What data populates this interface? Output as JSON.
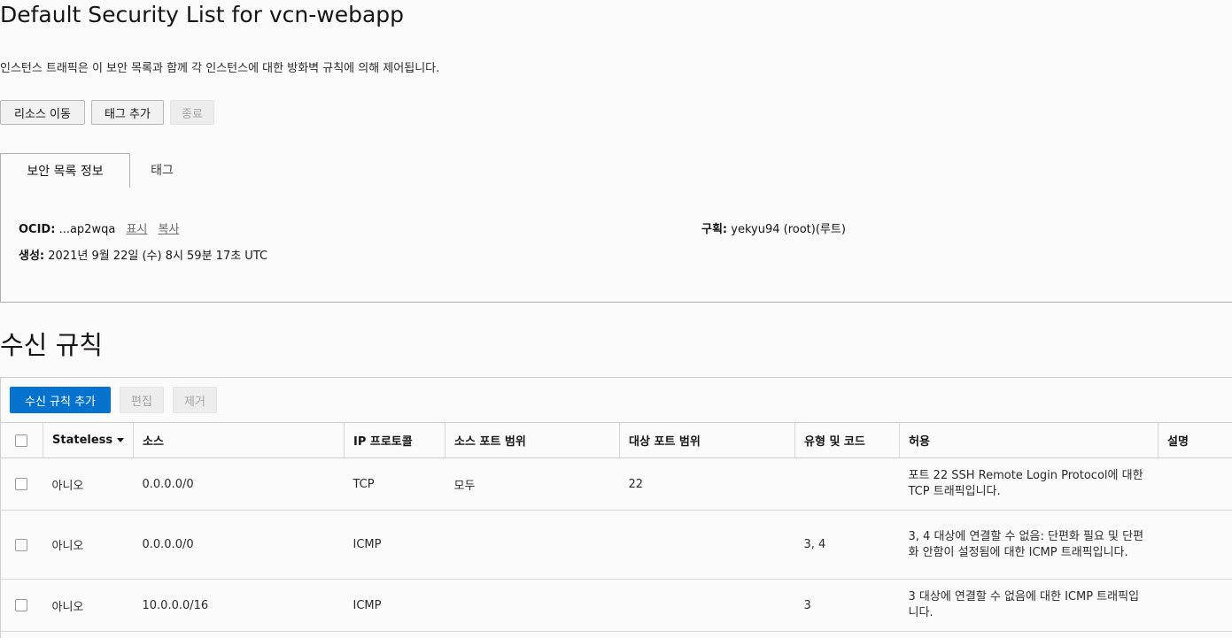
{
  "page": {
    "title": "Default Security List for vcn-webapp",
    "description": "인스턴스 트래픽은 이 보안 목록과 함께 각 인스턴스에 대한 방화벽 규칙에 의해 제어됩니다."
  },
  "actions": {
    "move_resource": "리소스 이동",
    "add_tags": "태그 추가",
    "terminate": "종료"
  },
  "tabs": [
    {
      "label": "보안 목록 정보",
      "active": true
    },
    {
      "label": "태그",
      "active": false
    }
  ],
  "info": {
    "ocid_label": "OCID:",
    "ocid_value": "...ap2wqa",
    "show_link": "표시",
    "copy_link": "복사",
    "created_label": "생성:",
    "created_value": "2021년 9월 22일 (수) 8시 59분 17초 UTC",
    "compartment_label": "구획:",
    "compartment_value": "yekyu94 (root)(루트)"
  },
  "ingress": {
    "title": "수신 규칙",
    "add_button": "수신 규칙 추가",
    "edit_button": "편집",
    "remove_button": "제거",
    "columns": [
      "Stateless",
      "소스",
      "IP 프로토콜",
      "소스 포트 범위",
      "대상 포트 범위",
      "유형 및 코드",
      "허용",
      "설명"
    ],
    "rows": [
      {
        "stateless": "아니오",
        "source": "0.0.0.0/0",
        "protocol": "TCP",
        "src_port": "모두",
        "dst_port": "22",
        "type_code": "",
        "allows": "포트 22 SSH Remote Login Protocol에 대한 TCP 트래픽입니다.",
        "description": ""
      },
      {
        "stateless": "아니오",
        "source": "0.0.0.0/0",
        "protocol": "ICMP",
        "src_port": "",
        "dst_port": "",
        "type_code": "3, 4",
        "allows": "3, 4 대상에 연결할 수 없음: 단편화 필요 및 단편화 안함이 설정됨에 대한 ICMP 트래픽입니다.",
        "description": ""
      },
      {
        "stateless": "아니오",
        "source": "10.0.0.0/16",
        "protocol": "ICMP",
        "src_port": "",
        "dst_port": "",
        "type_code": "3",
        "allows": "3 대상에 연결할 수 없음에 대한 ICMP 트래픽입니다.",
        "description": ""
      }
    ]
  },
  "colors": {
    "primary": "#0572ce",
    "border": "#b0b0b0",
    "background": "#fbfbfb"
  }
}
